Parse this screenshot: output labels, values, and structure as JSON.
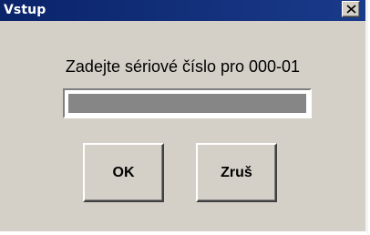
{
  "dialog": {
    "title": "Vstup",
    "prompt": "Zadejte sériové číslo pro 000-01",
    "serial_input": {
      "value": "",
      "placeholder": ""
    },
    "buttons": {
      "ok_label": "OK",
      "cancel_label": "Zruš"
    }
  },
  "icons": {
    "close": "close-icon"
  },
  "colors": {
    "titlebar": "#0a246a",
    "dialog_face": "#d4d0c8",
    "input_fill": "#868686"
  }
}
